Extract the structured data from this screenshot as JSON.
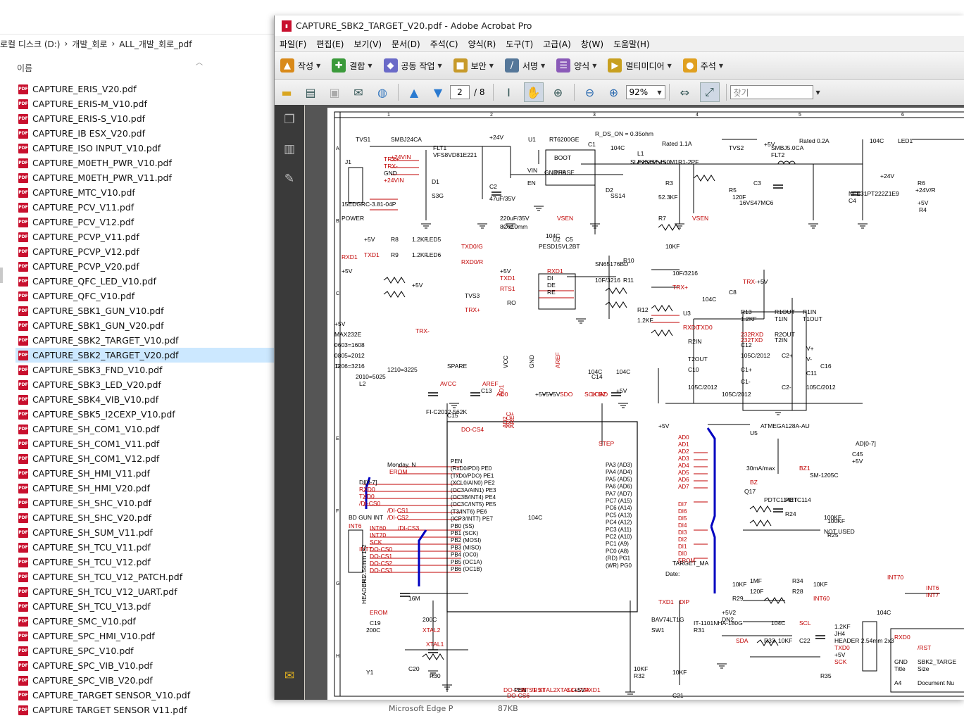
{
  "explorer": {
    "breadcrumb": [
      "로컬 디스크 (D:)",
      "›",
      "개발_회로",
      "›",
      "ALL_개발_회로_pdf"
    ],
    "column_name": "이름",
    "files": [
      "CAPTURE_ERIS_V20.pdf",
      "CAPTURE_ERIS-M_V10.pdf",
      "CAPTURE_ERIS-S_V10.pdf",
      "CAPTURE_IB ESX_V20.pdf",
      "CAPTURE_ISO INPUT_V10.pdf",
      "CAPTURE_M0ETH_PWR_V10.pdf",
      "CAPTURE_M0ETH_PWR_V11.pdf",
      "CAPTURE_MTC_V10.pdf",
      "CAPTURE_PCV_V11.pdf",
      "CAPTURE_PCV_V12.pdf",
      "CAPTURE_PCVP_V11.pdf",
      "CAPTURE_PCVP_V12.pdf",
      "CAPTURE_PCVP_V20.pdf",
      "CAPTURE_QFC_LED_V10.pdf",
      "CAPTURE_QFC_V10.pdf",
      "CAPTURE_SBK1_GUN_V10.pdf",
      "CAPTURE_SBK1_GUN_V20.pdf",
      "CAPTURE_SBK2_TARGET_V10.pdf",
      "CAPTURE_SBK2_TARGET_V20.pdf",
      "CAPTURE_SBK3_FND_V10.pdf",
      "CAPTURE_SBK3_LED_V20.pdf",
      "CAPTURE_SBK4_VIB_V10.pdf",
      "CAPTURE_SBK5_I2CEXP_V10.pdf",
      "CAPTURE_SH_COM1_V10.pdf",
      "CAPTURE_SH_COM1_V11.pdf",
      "CAPTURE_SH_COM1_V12.pdf",
      "CAPTURE_SH_HMI_V11.pdf",
      "CAPTURE_SH_HMI_V20.pdf",
      "CAPTURE_SH_SHC_V10.pdf",
      "CAPTURE_SH_SHC_V20.pdf",
      "CAPTURE_SH_SUM_V11.pdf",
      "CAPTURE_SH_TCU_V11.pdf",
      "CAPTURE_SH_TCU_V12.pdf",
      "CAPTURE_SH_TCU_V12_PATCH.pdf",
      "CAPTURE_SH_TCU_V12_UART.pdf",
      "CAPTURE_SH_TCU_V13.pdf",
      "CAPTURE_SMC_V10.pdf",
      "CAPTURE_SPC_HMI_V10.pdf",
      "CAPTURE_SPC_V10.pdf",
      "CAPTURE_SPC_VIB_V10.pdf",
      "CAPTURE_SPC_VIB_V20.pdf",
      "CAPTURE_TARGET SENSOR_V10.pdf",
      "CAPTURE TARGET SENSOR V11.pdf"
    ],
    "selected_index": 18,
    "status_type": "Microsoft Edge P",
    "status_size": "87KB"
  },
  "acrobat": {
    "title": "CAPTURE_SBK2_TARGET_V20.pdf - Adobe Acrobat Pro",
    "menu": [
      "파일(F)",
      "편집(E)",
      "보기(V)",
      "문서(D)",
      "주석(C)",
      "양식(R)",
      "도구(T)",
      "고급(A)",
      "창(W)",
      "도움말(H)"
    ],
    "toolbar1": [
      {
        "label": "작성",
        "icon": "create-icon",
        "color": "#d98a1a"
      },
      {
        "label": "결합",
        "icon": "combine-icon",
        "color": "#3a9a3a"
      },
      {
        "label": "공동 작업",
        "icon": "collaborate-icon",
        "color": "#6a6ac8"
      },
      {
        "label": "보안",
        "icon": "lock-icon",
        "color": "#c79a2a"
      },
      {
        "label": "서명",
        "icon": "sign-icon",
        "color": "#557799"
      },
      {
        "label": "양식",
        "icon": "form-icon",
        "color": "#8a5ab8"
      },
      {
        "label": "멀티미디어",
        "icon": "multimedia-icon",
        "color": "#c8a020"
      },
      {
        "label": "주석",
        "icon": "comment-icon",
        "color": "#e0a020"
      }
    ],
    "page_current": "2",
    "page_total": "/ 8",
    "zoom": "92%",
    "search_placeholder": "찾기"
  },
  "schematic": {
    "grid_cols": [
      "1",
      "2",
      "3",
      "4",
      "5",
      "6"
    ],
    "grid_rows": [
      "A",
      "B",
      "C",
      "D",
      "E",
      "F",
      "G",
      "H"
    ],
    "labels": [
      {
        "t": "R_DS_ON = 0.35ohm"
      },
      {
        "t": "Rated 1.1A"
      },
      {
        "t": "Rated 0.2A"
      },
      {
        "t": "TVS1"
      },
      {
        "t": "SMBJ24CA"
      },
      {
        "t": "+24V"
      },
      {
        "t": "U1"
      },
      {
        "t": "RT6200GE"
      },
      {
        "t": "TVS2"
      },
      {
        "t": "+5V"
      },
      {
        "t": "LED1"
      },
      {
        "t": "FLT1"
      },
      {
        "t": "VFS8VD81E221"
      },
      {
        "t": "+24VIN"
      },
      {
        "t": "J1"
      },
      {
        "t": "TRX+"
      },
      {
        "t": "TRX-"
      },
      {
        "t": "GND"
      },
      {
        "t": "+24VIN"
      },
      {
        "t": "15EDGRC-3.81-04P"
      },
      {
        "t": "POWER"
      },
      {
        "t": "D1"
      },
      {
        "t": "S3G"
      },
      {
        "t": "C2"
      },
      {
        "t": "47uF/35V"
      },
      {
        "t": "220uF/35V"
      },
      {
        "t": "8Øx10mm"
      },
      {
        "t": "VIN"
      },
      {
        "t": "EN"
      },
      {
        "t": "BOOT"
      },
      {
        "t": "PHASE"
      },
      {
        "t": "GND"
      },
      {
        "t": "FB"
      },
      {
        "t": "VSEN"
      },
      {
        "t": "C1"
      },
      {
        "t": "104C"
      },
      {
        "t": "L1"
      },
      {
        "t": "SLF7032T-150M1R1-2PF"
      },
      {
        "t": "D2"
      },
      {
        "t": "SS14"
      },
      {
        "t": "R3"
      },
      {
        "t": "52.3KF"
      },
      {
        "t": "R7"
      },
      {
        "t": "10KF"
      },
      {
        "t": "VSEN"
      },
      {
        "t": "R5"
      },
      {
        "t": "120F"
      },
      {
        "t": "16VS47MC6"
      },
      {
        "t": "C3"
      },
      {
        "t": "SMBJ5.0CA"
      },
      {
        "t": "FLT2"
      },
      {
        "t": "NFE31PT222Z1E9"
      },
      {
        "t": "C4"
      },
      {
        "t": "104C"
      },
      {
        "t": "+24V"
      },
      {
        "t": "+24V/R"
      },
      {
        "t": "R4"
      },
      {
        "t": "R6"
      },
      {
        "t": "+5V"
      },
      {
        "t": "+5V"
      },
      {
        "t": "R8"
      },
      {
        "t": "1.2KF"
      },
      {
        "t": "LED5"
      },
      {
        "t": "TXD0/G"
      },
      {
        "t": "TXD1"
      },
      {
        "t": "R9"
      },
      {
        "t": "1.2KF"
      },
      {
        "t": "LED6"
      },
      {
        "t": "RXD0/R"
      },
      {
        "t": "RXD1"
      },
      {
        "t": "+5V"
      },
      {
        "t": "+5V"
      },
      {
        "t": "TVS3"
      },
      {
        "t": "TRX+"
      },
      {
        "t": "TRX-"
      },
      {
        "t": "PESD15VL2BT"
      },
      {
        "t": "U2"
      },
      {
        "t": "C5"
      },
      {
        "t": "104C"
      },
      {
        "t": "+5V"
      },
      {
        "t": "TXD1"
      },
      {
        "t": "RTS1"
      },
      {
        "t": "RXD1"
      },
      {
        "t": "DI"
      },
      {
        "t": "DE"
      },
      {
        "t": "RE"
      },
      {
        "t": "RO"
      },
      {
        "t": "SN65176BD"
      },
      {
        "t": "R10"
      },
      {
        "t": "10F/3216"
      },
      {
        "t": "R11"
      },
      {
        "t": "10F/3216"
      },
      {
        "t": "TRX+"
      },
      {
        "t": "TRX-"
      },
      {
        "t": "+5V"
      },
      {
        "t": "C8"
      },
      {
        "t": "104C"
      },
      {
        "t": "U3"
      },
      {
        "t": "R12"
      },
      {
        "t": "1.2KF"
      },
      {
        "t": "RXD0"
      },
      {
        "t": "TXD0"
      },
      {
        "t": "R13"
      },
      {
        "t": "1.2KF"
      },
      {
        "t": "R1OUT"
      },
      {
        "t": "T1IN"
      },
      {
        "t": "R1IN"
      },
      {
        "t": "T1OUT"
      },
      {
        "t": "232RXD"
      },
      {
        "t": "232TXD"
      },
      {
        "t": "R2OUT"
      },
      {
        "t": "T2IN"
      },
      {
        "t": "R2IN"
      },
      {
        "t": "T2OUT"
      },
      {
        "t": "C10"
      },
      {
        "t": "105C/2012"
      },
      {
        "t": "C12"
      },
      {
        "t": "105C/2012"
      },
      {
        "t": "C1+"
      },
      {
        "t": "C1-"
      },
      {
        "t": "C2+"
      },
      {
        "t": "C2-"
      },
      {
        "t": "V+"
      },
      {
        "t": "V-"
      },
      {
        "t": "C11"
      },
      {
        "t": "105C/2012"
      },
      {
        "t": "C16"
      },
      {
        "t": "105C/2012"
      },
      {
        "t": "+5V"
      },
      {
        "t": "MAX232E"
      },
      {
        "t": "0603=1608"
      },
      {
        "t": "0805=2012"
      },
      {
        "t": "1206=3216"
      },
      {
        "t": "1210=3225"
      },
      {
        "t": "2010=5025"
      },
      {
        "t": "L2"
      },
      {
        "t": "FI-C2012-562K"
      },
      {
        "t": "SPARE"
      },
      {
        "t": "AVCC"
      },
      {
        "t": "AREF"
      },
      {
        "t": "C13"
      },
      {
        "t": "104C"
      },
      {
        "t": "C14"
      },
      {
        "t": "104C"
      },
      {
        "t": "+5V"
      },
      {
        "t": "C15"
      },
      {
        "t": "104C"
      },
      {
        "t": "+5V"
      },
      {
        "t": "U5"
      },
      {
        "t": "ATMEGA128A-AU"
      },
      {
        "t": "AD[0-7]"
      },
      {
        "t": "C45"
      },
      {
        "t": "+5V"
      },
      {
        "t": "30mA/max"
      },
      {
        "t": "BZ1"
      },
      {
        "t": "SM-1205C"
      },
      {
        "t": "BZ"
      },
      {
        "t": "Q17"
      },
      {
        "t": "PDTC114ET"
      },
      {
        "t": "PDTC114"
      },
      {
        "t": "R24"
      },
      {
        "t": "100KF"
      },
      {
        "t": "R25"
      },
      {
        "t": "100KF"
      },
      {
        "t": "NOT USED"
      },
      {
        "t": "BD GUN INT"
      },
      {
        "t": "INT6"
      },
      {
        "t": "INT7"
      },
      {
        "t": "JH1"
      },
      {
        "t": "HEADER 2.54mm 1x2"
      },
      {
        "t": "EROM"
      },
      {
        "t": "C19"
      },
      {
        "t": "200C"
      },
      {
        "t": "Y1"
      },
      {
        "t": "16M"
      },
      {
        "t": "C20"
      },
      {
        "t": "200C"
      },
      {
        "t": "XTAL2"
      },
      {
        "t": "XTAL1"
      },
      {
        "t": "R30"
      },
      {
        "t": "1MF"
      },
      {
        "t": "R34"
      },
      {
        "t": "120F"
      },
      {
        "t": "R28"
      },
      {
        "t": "10KF"
      },
      {
        "t": "R29"
      },
      {
        "t": "10KF"
      },
      {
        "t": "INT60"
      },
      {
        "t": "INT70"
      },
      {
        "t": "INT6"
      },
      {
        "t": "INT7"
      },
      {
        "t": "+5V2"
      },
      {
        "t": "DN2"
      },
      {
        "t": "BAV74LT1G"
      },
      {
        "t": "SW1"
      },
      {
        "t": "IT-1101NHA-180G"
      },
      {
        "t": "R31"
      },
      {
        "t": "10KF"
      },
      {
        "t": "R32"
      },
      {
        "t": "10KF"
      },
      {
        "t": "C21"
      },
      {
        "t": "104C"
      },
      {
        "t": "SCL"
      },
      {
        "t": "SDA"
      },
      {
        "t": "R33"
      },
      {
        "t": "10KF"
      },
      {
        "t": "C22"
      },
      {
        "t": "104C"
      },
      {
        "t": "R35"
      },
      {
        "t": "1.2KF"
      },
      {
        "t": "JH4"
      },
      {
        "t": "HEADER 2.54mm 2x3"
      },
      {
        "t": "TXD0"
      },
      {
        "t": "+5V"
      },
      {
        "t": "SCK"
      },
      {
        "t": "RXD0"
      },
      {
        "t": "/RST"
      },
      {
        "t": "GND"
      },
      {
        "t": "Title"
      },
      {
        "t": "SBK2_TARGE"
      },
      {
        "t": "Size"
      },
      {
        "t": "A4"
      },
      {
        "t": "Document Nu"
      },
      {
        "t": "TARGET_MA"
      },
      {
        "t": "Date:"
      },
      {
        "t": "Monday, N"
      },
      {
        "t": "EROM"
      },
      {
        "t": "DI[0-7]"
      },
      {
        "t": "RXD0"
      },
      {
        "t": "TXD0"
      },
      {
        "t": "/DI-CS0"
      },
      {
        "t": "/DI-CS1"
      },
      {
        "t": "/DI-CS2"
      },
      {
        "t": "/DI-CS3"
      },
      {
        "t": "INT60"
      },
      {
        "t": "INT70"
      },
      {
        "t": "SCK"
      },
      {
        "t": "DO-CS0"
      },
      {
        "t": "DO-CS1"
      },
      {
        "t": "DO-CS2"
      },
      {
        "t": "DO-CS3"
      },
      {
        "t": "DO-CS4"
      },
      {
        "t": "DO-CS5"
      },
      {
        "t": "DO-CS6"
      },
      {
        "t": "PEN"
      },
      {
        "t": "RTS1"
      },
      {
        "t": "/RST"
      },
      {
        "t": "XTAL2"
      },
      {
        "t": "XTAL1"
      },
      {
        "t": "SCL"
      },
      {
        "t": "SDA"
      },
      {
        "t": "RXD1"
      },
      {
        "t": "TXD1"
      },
      {
        "t": "DIP"
      },
      {
        "t": "STEP"
      },
      {
        "t": "+5V"
      },
      {
        "t": "+5V"
      },
      {
        "t": "+5V"
      },
      {
        "t": "+5V"
      },
      {
        "t": "SDO"
      },
      {
        "t": "SCK"
      },
      {
        "t": "LOAD"
      },
      {
        "t": "BZ"
      },
      {
        "t": "AD0"
      },
      {
        "t": "AD1"
      },
      {
        "t": "AD2"
      },
      {
        "t": "AVCC"
      },
      {
        "t": "AREF"
      },
      {
        "t": "VCC"
      },
      {
        "t": "GND"
      },
      {
        "t": "AREF"
      }
    ],
    "mcu_left_pins": [
      "PEN",
      "(RxD0/PDI) PE0",
      "(TxD0/PDO) PE1",
      "(XCL0/AIN0) PE2",
      "(OC3A/AIN1) PE3",
      "(OC3B/INT4) PE4",
      "(OC3C/INT5) PE5",
      "(T3/INT6) PE6",
      "(ICP3/INT7) PE7",
      "PB0 (SS)",
      "PB1 (SCK)",
      "PB2 (MOSI)",
      "PB3 (MISO)",
      "PB4 (OC0)",
      "PB5 (OC1A)",
      "PB6 (OC1B)"
    ],
    "mcu_right_pins": [
      "PA3 (AD3)",
      "PA4 (AD4)",
      "PA5 (AD5)",
      "PA6 (AD6)",
      "PA7 (AD7)",
      "PC7 (A15)",
      "PC6 (A14)",
      "PC5 (A13)",
      "PC4 (A12)",
      "PC3 (A11)",
      "PC2 (A10)",
      "PC1 (A9)",
      "PC0 (A8)",
      "(RD) PG1",
      "(WR) PG0"
    ],
    "ad_bus": [
      "AD0",
      "AD1",
      "AD2",
      "AD3",
      "AD4",
      "AD5",
      "AD6",
      "AD7"
    ],
    "di_bus": [
      "DI7",
      "DI6",
      "DI5",
      "DI4",
      "DI3",
      "DI2",
      "DI1",
      "DI0",
      "EROM"
    ]
  }
}
